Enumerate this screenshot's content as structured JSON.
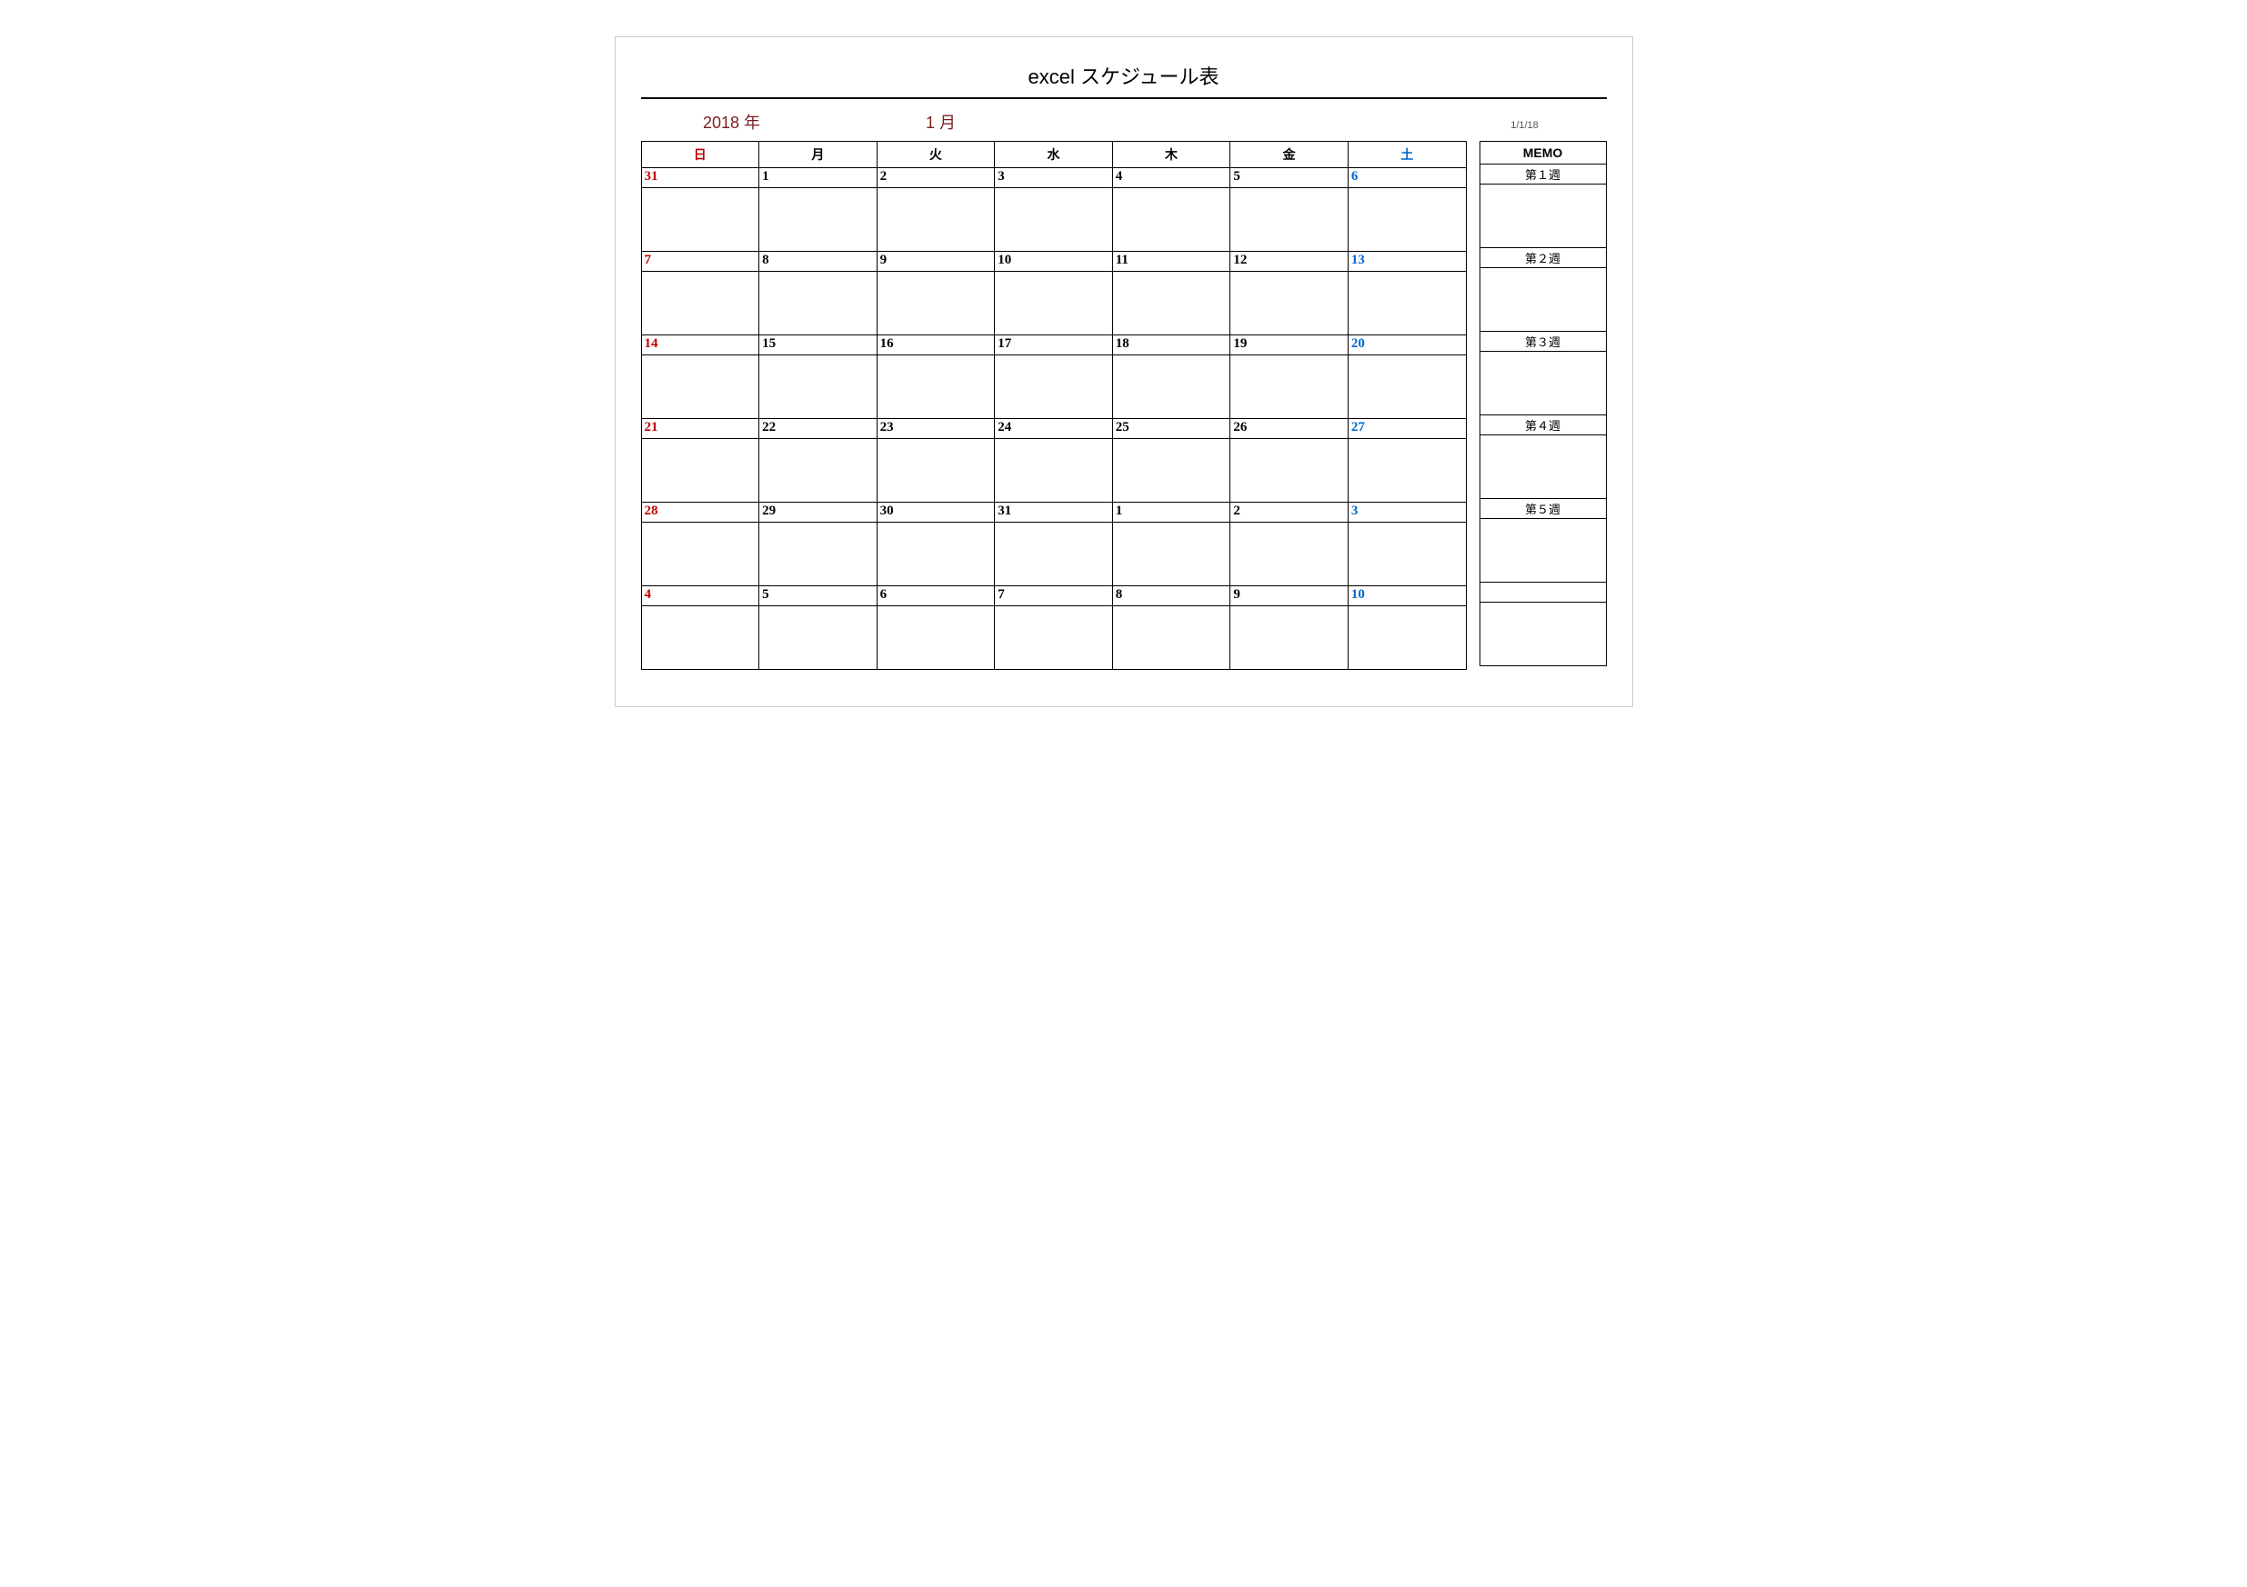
{
  "title": "excel スケジュール表",
  "year_label": "2018 年",
  "month_label": "1 月",
  "date_small": "1/1/18",
  "dow": [
    "日",
    "月",
    "火",
    "水",
    "木",
    "金",
    "土"
  ],
  "memo_header": "MEMO",
  "weeks": [
    {
      "label": "第１週",
      "days": [
        "31",
        "1",
        "2",
        "3",
        "4",
        "5",
        "6"
      ]
    },
    {
      "label": "第２週",
      "days": [
        "7",
        "8",
        "9",
        "10",
        "11",
        "12",
        "13"
      ]
    },
    {
      "label": "第３週",
      "days": [
        "14",
        "15",
        "16",
        "17",
        "18",
        "19",
        "20"
      ]
    },
    {
      "label": "第４週",
      "days": [
        "21",
        "22",
        "23",
        "24",
        "25",
        "26",
        "27"
      ]
    },
    {
      "label": "第５週",
      "days": [
        "28",
        "29",
        "30",
        "31",
        "1",
        "2",
        "3"
      ]
    },
    {
      "label": "",
      "days": [
        "4",
        "5",
        "6",
        "7",
        "8",
        "9",
        "10"
      ]
    }
  ]
}
